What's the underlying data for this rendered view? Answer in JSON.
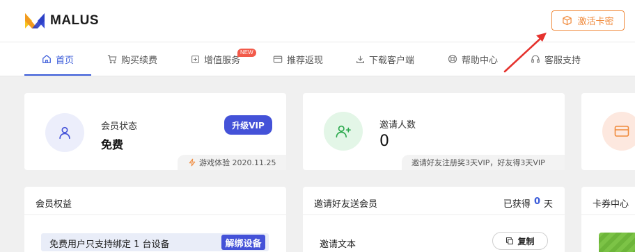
{
  "brand": {
    "name": "MALUS"
  },
  "header": {
    "activate_label": "激活卡密"
  },
  "nav": {
    "items": [
      {
        "label": "首页",
        "icon": "home-icon"
      },
      {
        "label": "购买续费",
        "icon": "cart-icon"
      },
      {
        "label": "增值服务",
        "icon": "plus-square-icon"
      },
      {
        "label": "推荐返现",
        "icon": "card-icon"
      },
      {
        "label": "下载客户端",
        "icon": "download-icon"
      },
      {
        "label": "帮助中心",
        "icon": "help-icon"
      },
      {
        "label": "客服支持",
        "icon": "headset-icon"
      }
    ],
    "new_badge": "NEW"
  },
  "member": {
    "label": "会员状态",
    "value": "免费",
    "upgrade_label": "升级VIP",
    "trial_tag": "游戏体验 2020.11.25"
  },
  "invite": {
    "label": "邀请人数",
    "value": "0",
    "note": "邀请好友注册奖3天VIP，好友得3天VIP"
  },
  "benefits": {
    "title": "会员权益",
    "notice": "免费用户只支持绑定 1 台设备",
    "unbind_label": "解绑设备"
  },
  "invite_panel": {
    "title": "邀请好友送会员",
    "earned_prefix": "已获得",
    "earned_value": "0",
    "earned_unit": "天",
    "text_label": "邀请文本",
    "copy_label": "复制"
  },
  "coupon": {
    "title": "卡券中心"
  },
  "colors": {
    "accent": "#3a5bd9",
    "orange": "#f08a3c",
    "upgrade": "#4452d8",
    "arrow": "#e5322d"
  }
}
